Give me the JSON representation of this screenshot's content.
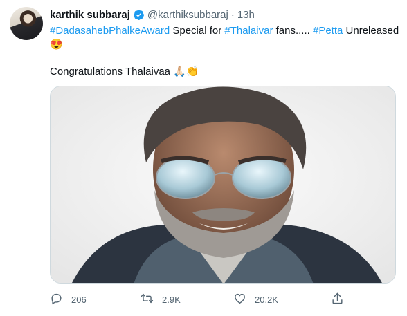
{
  "tweet": {
    "author_name": "karthik subbaraj",
    "handle": "@karthiksubbaraj",
    "separator": "·",
    "time": "13h",
    "text": {
      "hashtag1": "#DadasahebPhalkeAward",
      "plain1": " Special for ",
      "hashtag2": "#Thalaivar",
      "plain2": " fans..... ",
      "hashtag3": "#Petta",
      "plain3": " Unreleased",
      "emoji1": "😍",
      "congrats": "Congratulations Thalaivaa ",
      "emoji2": "🙏🏻👏"
    }
  },
  "actions": {
    "reply_count": "206",
    "retweet_count": "2.9K",
    "like_count": "20.2K"
  },
  "icons": [
    "verified-badge-icon",
    "reply-icon",
    "retweet-icon",
    "like-icon",
    "share-icon"
  ],
  "colors": {
    "accent": "#1d9bf0",
    "muted": "#536471",
    "text": "#0f1419"
  }
}
